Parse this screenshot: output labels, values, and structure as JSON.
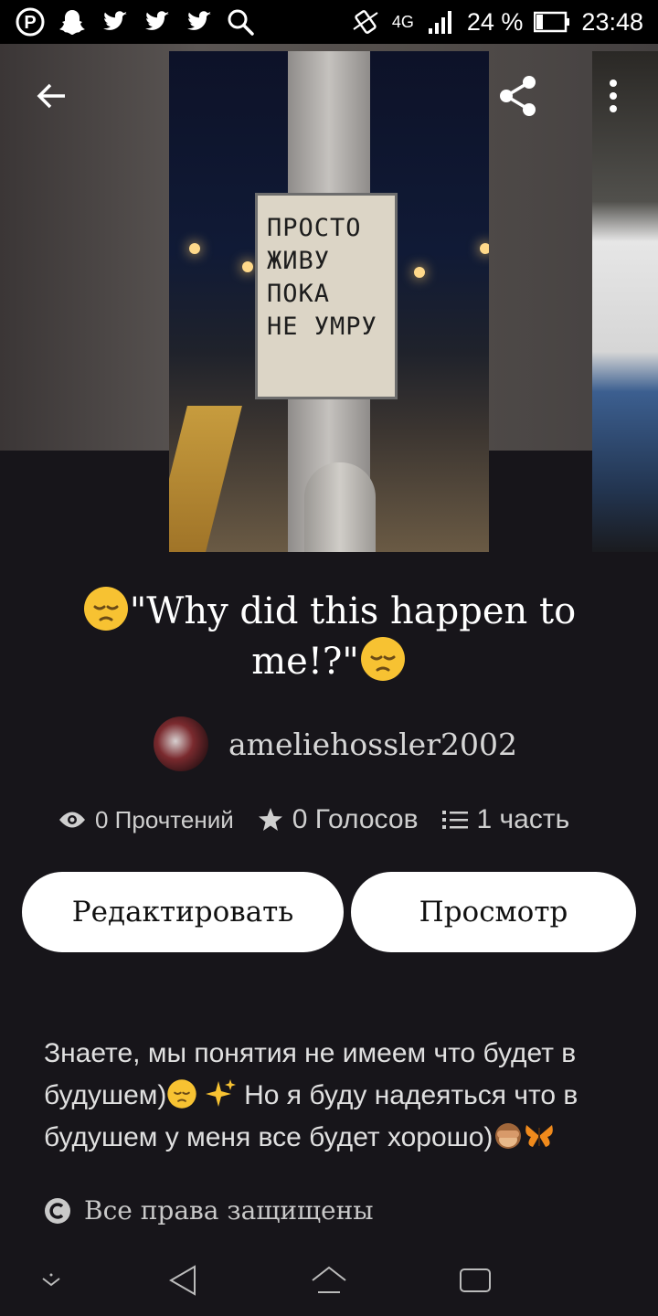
{
  "status_bar": {
    "network": "4G",
    "battery": "24 %",
    "time": "23:48",
    "left_icons": [
      "pinterest-icon",
      "snapchat-icon",
      "twitter-icon",
      "twitter-icon",
      "twitter-icon",
      "search-icon"
    ]
  },
  "cover": {
    "sign_lines": [
      "ПРОСТО",
      "ЖИВУ",
      "ПОКА",
      "НЕ УМРУ"
    ]
  },
  "story": {
    "title": "\"Why did this happen to me!?\"",
    "author": "ameliehossler2002",
    "reads": "0 Прочтений",
    "votes": "0 Голосов",
    "parts": "1 часть"
  },
  "actions": {
    "edit_label": "Редактировать",
    "view_label": "Просмотр"
  },
  "description": {
    "part1": "Знаете, мы понятия не имеем что будет в будушем)",
    "part2": " Но я буду надеяться что в будушем у меня все будет хорошо)"
  },
  "copyright": "Все права защищены",
  "colors": {
    "background": "#17151a",
    "button_bg": "#ffffff",
    "emoji_yellow": "#f7c232"
  }
}
